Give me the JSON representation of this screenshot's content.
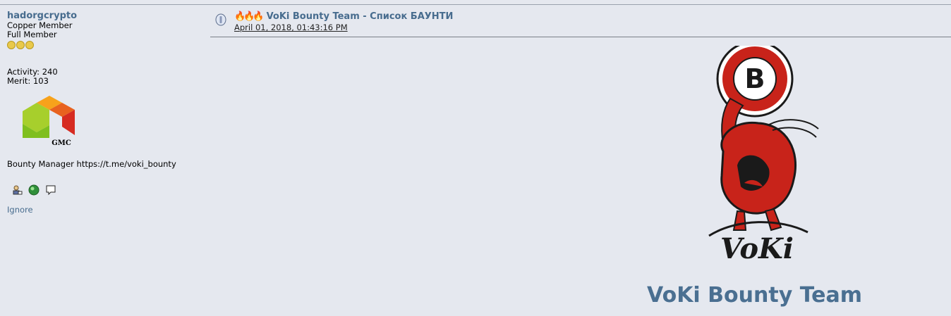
{
  "profile": {
    "username": "hadorgcrypto",
    "rank": "Copper Member",
    "membership": "Full Member",
    "activity": "Activity: 240",
    "merit": "Merit: 103",
    "avatar_label": "GMC",
    "signature": "Bounty Manager https://t.me/voki_bounty",
    "ignore_label": "Ignore",
    "icons": [
      "profile-icon",
      "website-icon",
      "pm-icon"
    ]
  },
  "post": {
    "flames": "🔥🔥🔥",
    "title": "VoKi Bounty Team - Список БАУНТИ",
    "date": "April 01, 2018, 01:43:16 PM"
  },
  "image": {
    "logo_text": "VoKi",
    "coin_symbol": "B",
    "banner": "VoKi Bounty Team"
  },
  "colors": {
    "accent": "#476c8e",
    "background": "#e5e8ef",
    "logo_red": "#c8231a"
  }
}
